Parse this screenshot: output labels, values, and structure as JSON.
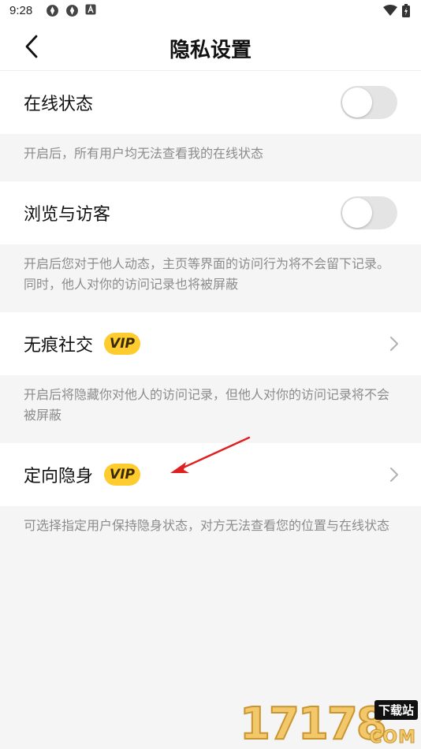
{
  "status_bar": {
    "time": "9:28"
  },
  "header": {
    "title": "隐私设置"
  },
  "settings": [
    {
      "label": "在线状态",
      "control": "toggle",
      "on": false,
      "description": "开启后，所有用户均无法查看我的在线状态"
    },
    {
      "label": "浏览与访客",
      "control": "toggle",
      "on": false,
      "description": "开启后您对于他人动态，主页等界面的访问行为将不会留下记录。同时，他人对你的访问记录也将被屏蔽"
    },
    {
      "label": "无痕社交",
      "badge": "VIP",
      "control": "chevron",
      "description": "开启后将隐藏你对他人的访问记录，但他人对你的访问记录将不会被屏蔽"
    },
    {
      "label": "定向隐身",
      "badge": "VIP",
      "control": "chevron",
      "description": "可选择指定用户保持隐身状态，对方无法查看您的位置与在线状态"
    }
  ],
  "watermark": {
    "number": "17178",
    "tag": "下载站",
    "suffix": "COM"
  },
  "colors": {
    "vip_badge": "#ffcc2f",
    "toggle_off": "#e4e4e4",
    "arrow": "#e02020",
    "background": "#f5f5f5"
  }
}
